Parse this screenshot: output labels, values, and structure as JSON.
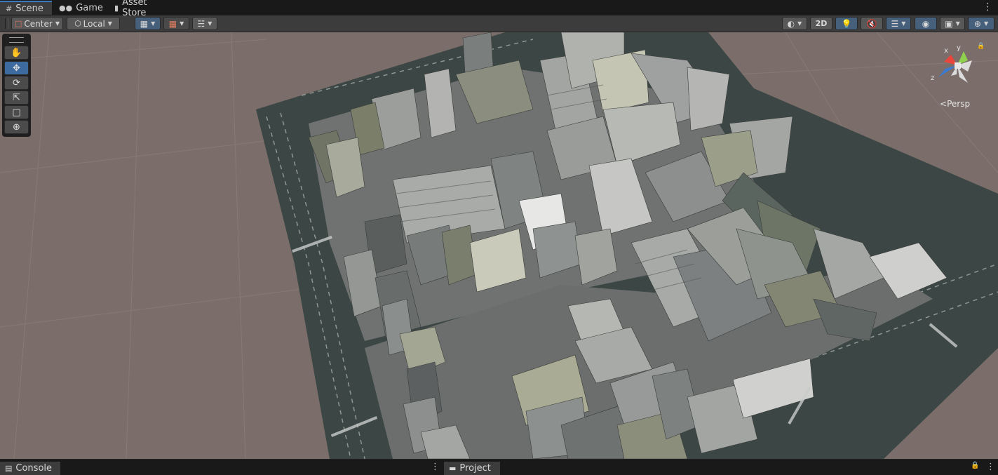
{
  "tabs": [
    {
      "label": "Scene",
      "icon": "grid-icon",
      "active": true
    },
    {
      "label": "Game",
      "icon": "gamepad-icon",
      "active": false
    },
    {
      "label": "Asset Store",
      "icon": "store-bag-icon",
      "active": false
    }
  ],
  "toolbar": {
    "pivot_label": "Center",
    "space_label": "Local",
    "mode_2d_label": "2D"
  },
  "tools": [
    {
      "name": "hand-tool",
      "icon": "hand-icon"
    },
    {
      "name": "move-tool",
      "icon": "move-arrows-icon",
      "active": true
    },
    {
      "name": "rotate-tool",
      "icon": "rotate-icon"
    },
    {
      "name": "scale-tool",
      "icon": "scale-icon"
    },
    {
      "name": "rect-tool",
      "icon": "rect-icon"
    },
    {
      "name": "transform-tool",
      "icon": "transform-icon"
    }
  ],
  "gizmo": {
    "axis_x": "x",
    "axis_y": "y",
    "axis_z": "z",
    "projection_label": "Persp",
    "colors": {
      "x": "#e8453c",
      "y": "#8fd14f",
      "z": "#3a7bd5"
    }
  },
  "bottom_tabs": [
    {
      "label": "Console",
      "icon": "console-icon"
    },
    {
      "label": "Project",
      "icon": "folder-icon"
    }
  ],
  "colors": {
    "scene_background": "#7b6e6a",
    "accent": "#3a79bb",
    "road": "#3c4745",
    "building_light": "#a9aaa6",
    "building_dark": "#5e6260"
  }
}
